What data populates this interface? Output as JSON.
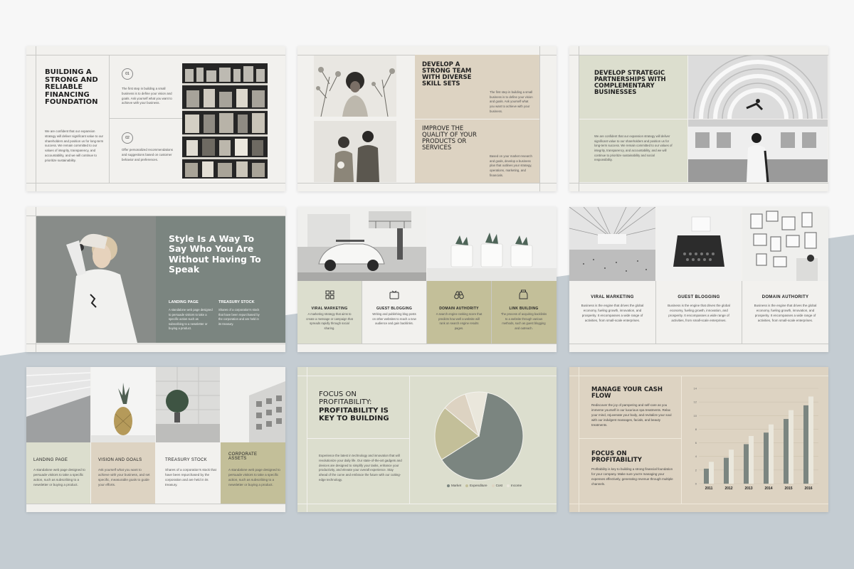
{
  "colors": {
    "beige": "#ddd3c2",
    "sage": "#dcdece",
    "olive": "#c3bf99",
    "slate": "#7b8580",
    "bg": "#f7f7f7",
    "band": "#c4ccd2"
  },
  "s1": {
    "title": "BUILDING A STRONG AND RELIABLE FINANCING FOUNDATION",
    "num1": "01",
    "num2": "02",
    "text1": "The first step in building a small business is to define your vision and goals. Ask yourself what you want to achieve with your business.",
    "text2": "Offer personalized recommendations and suggestions based on customer behavior and preferences.",
    "body": "We are confident that our expansion strategy will deliver significant value to our shareholders and position us for long-term success. We remain committed to our values of integrity, transparency, and accountability, and we will continue to prioritize sustainability."
  },
  "s2": {
    "title1": "DEVELOP A STRONG TEAM WITH DIVERSE SKILL SETS",
    "text1": "The first step in building a small business is to define your vision and goals. Ask yourself what you want to achieve with your business.",
    "title2": "IMPROVE THE QUALITY OF YOUR PRODUCTS OR SERVICES",
    "text2": "Based on your market research and goals, develop a business plan that outlines your strategy, operations, marketing, and financials."
  },
  "s3": {
    "title": "DEVELOP STRATEGIC PARTNERSHIPS WITH COMPLEMENTARY BUSINESSES",
    "body": "We are confident that our expansion strategy will deliver significant value to our shareholders and position us for long-term success. We remain committed to our values of integrity, transparency, and accountability, and we will continue to prioritize sustainability and social responsibility."
  },
  "s4": {
    "title": "Style Is A Way To Say Who You Are Without Having To Speak",
    "col1_title": "LANDING PAGE",
    "col1_text": "A standalone web page designed to persuade visitors to take a specific action such as subscribing to a newsletter or buying a product.",
    "col2_title": "TREASURY STOCK",
    "col2_text": "Shares of a corporation's stock that have been repurchased by the corporation and are held in its treasury."
  },
  "s5": {
    "items": [
      {
        "icon": "grid-icon",
        "title": "VIRAL MARKETING",
        "text": "A marketing strategy that aims to create a message or campaign that spreads rapidly through social sharing."
      },
      {
        "icon": "tv-icon",
        "title": "GUEST BLOGGING",
        "text": "Writing and publishing blog posts on other websites to reach a new audience and gain backlinks."
      },
      {
        "icon": "binoculars-icon",
        "title": "DOMAIN AUTHORITY",
        "text": "A search engine ranking score that predicts how well a website will rank on search engine results pages."
      },
      {
        "icon": "jar-icon",
        "title": "LINK BUILDING",
        "text": "The process of acquiring backlinks to a website through various methods, such as guest blogging and outreach."
      }
    ]
  },
  "s6": {
    "items": [
      {
        "title": "VIRAL MARKETING",
        "text": "Business is the engine that drives the global economy, fueling growth, innovation, and prosperity. It encompasses a wide range of activities, from small-scale enterprises."
      },
      {
        "title": "GUEST BLOGGING",
        "text": "Business is the engine that drives the global economy, fueling growth, innovation, and prosperity. It encompasses a wide range of activities, from small-scale enterprises."
      },
      {
        "title": "DOMAIN AUTHORITY",
        "text": "Business is the engine that drives the global economy, fueling growth, innovation, and prosperity. It encompasses a wide range of activities, from small-scale enterprises."
      }
    ]
  },
  "s7": {
    "items": [
      {
        "title": "LANDING PAGE",
        "text": "A standalone web page designed to persuade visitors to take a specific action, such as subscribing to a newsletter or buying a product."
      },
      {
        "title": "VISION AND GOALS",
        "text": "Ask yourself what you want to achieve with your business, and set specific, measurable goals to guide your efforts."
      },
      {
        "title": "TREASURY STOCK",
        "text": "Shares of a corporation's stock that have been repurchased by the corporation and are held in its treasury."
      },
      {
        "title": "CORPORATE ASSETS",
        "text": "A standalone web page designed to persuade visitors to take a specific action, such as subscribing to a newsletter or buying a product."
      }
    ]
  },
  "s8": {
    "title_a": "FOCUS ON PROFITABILITY:",
    "title_b": "PROFITABILITY IS KEY TO BUILDING",
    "body": "Experience the latest in technology and innovation that will revolutionize your daily life. Our state-of-the-art gadgets and devices are designed to simplify your tasks, enhance your productivity, and elevate your overall experience. Stay ahead of the curve and embrace the future with our cutting-edge technology."
  },
  "s9": {
    "title1": "MANAGE YOUR CASH FLOW",
    "text1": "Rediscover the joy of pampering and self-care as you immerse yourself in our luxurious spa treatments. Relax your mind, rejuvenate your body, and revitalize your soul with our indulgent massages, facials, and beauty treatments.",
    "title2": "FOCUS ON PROFITABILITY",
    "text2": "Profitability is key to building a strong financial foundation for your company. Make sure you're managing your expenses effectively, generating revenue through multiple channels."
  },
  "chart_data": [
    {
      "type": "pie",
      "title": "",
      "slices": [
        {
          "label": "Market",
          "value": 63,
          "color": "#7b8580"
        },
        {
          "label": "Expenditure",
          "value": 20,
          "color": "#c3bf99"
        },
        {
          "label": "Cost",
          "value": 9,
          "color": "#ddd3c2"
        },
        {
          "label": "Income",
          "value": 8,
          "color": "#eae7dc"
        }
      ]
    },
    {
      "type": "bar",
      "title": "",
      "categories": [
        "2011",
        "2012",
        "2013",
        "2014",
        "2015",
        "2016"
      ],
      "series": [
        {
          "values": [
            2.2,
            3.8,
            5.8,
            7.5,
            9.5,
            11.5
          ],
          "color": "#7b8580"
        },
        {
          "values": [
            3.2,
            5.0,
            7.0,
            8.7,
            10.8,
            12.8
          ],
          "color": "#eae7dc"
        }
      ],
      "yticks": [
        "0",
        "2",
        "4",
        "6",
        "8",
        "10",
        "12",
        "14"
      ],
      "ylim": [
        0,
        14
      ],
      "grid": true
    }
  ]
}
